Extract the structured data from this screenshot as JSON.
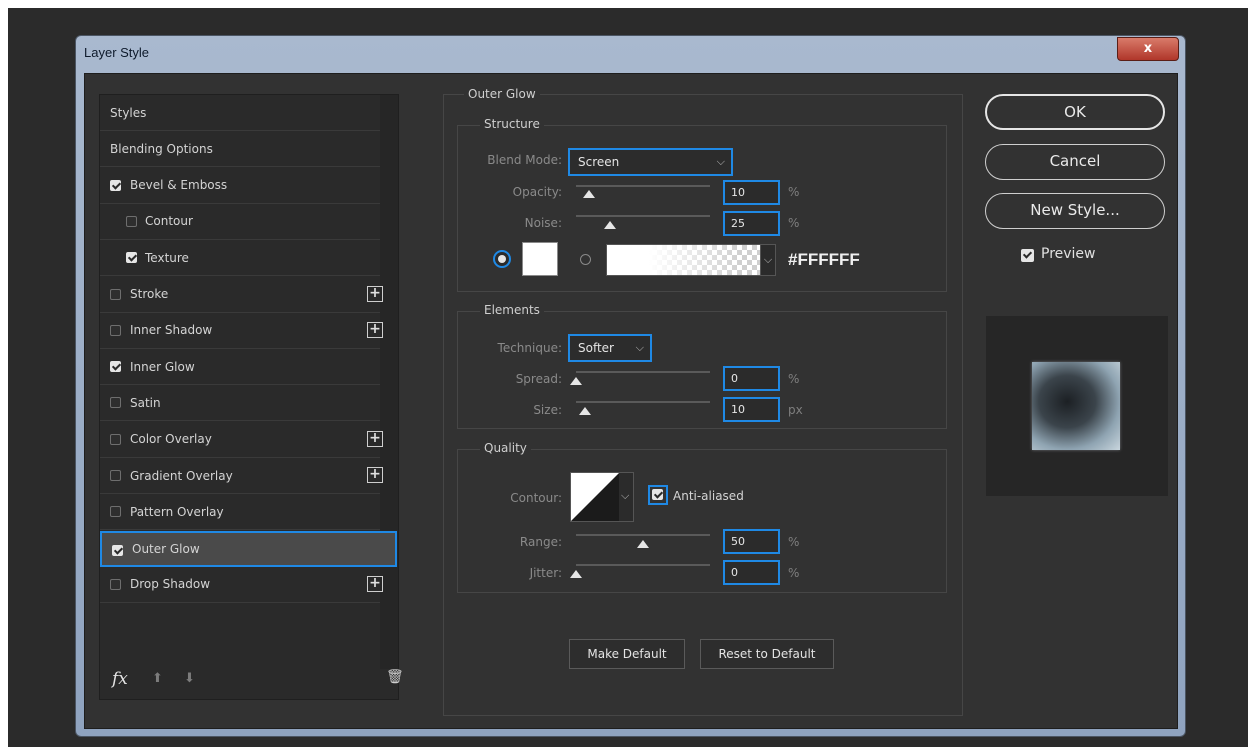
{
  "window": {
    "title": "Layer Style",
    "close_label": "x"
  },
  "sidebar": {
    "items": [
      {
        "label": "Styles",
        "checkbox": null,
        "plus": false,
        "sub": false,
        "selected": false
      },
      {
        "label": "Blending Options",
        "checkbox": null,
        "plus": false,
        "sub": false,
        "selected": false
      },
      {
        "label": "Bevel & Emboss",
        "checkbox": true,
        "plus": false,
        "sub": false,
        "selected": false
      },
      {
        "label": "Contour",
        "checkbox": false,
        "plus": false,
        "sub": true,
        "selected": false
      },
      {
        "label": "Texture",
        "checkbox": true,
        "plus": false,
        "sub": true,
        "selected": false
      },
      {
        "label": "Stroke",
        "checkbox": false,
        "plus": true,
        "sub": false,
        "selected": false
      },
      {
        "label": "Inner Shadow",
        "checkbox": false,
        "plus": true,
        "sub": false,
        "selected": false
      },
      {
        "label": "Inner Glow",
        "checkbox": true,
        "plus": false,
        "sub": false,
        "selected": false
      },
      {
        "label": "Satin",
        "checkbox": false,
        "plus": false,
        "sub": false,
        "selected": false
      },
      {
        "label": "Color Overlay",
        "checkbox": false,
        "plus": true,
        "sub": false,
        "selected": false
      },
      {
        "label": "Gradient Overlay",
        "checkbox": false,
        "plus": true,
        "sub": false,
        "selected": false
      },
      {
        "label": "Pattern Overlay",
        "checkbox": false,
        "plus": false,
        "sub": false,
        "selected": false
      },
      {
        "label": "Outer Glow",
        "checkbox": true,
        "plus": false,
        "sub": false,
        "selected": true
      },
      {
        "label": "Drop Shadow",
        "checkbox": false,
        "plus": true,
        "sub": false,
        "selected": false
      }
    ],
    "footer": {
      "fx_icon": "fx-icon",
      "up_icon": "arrow-up-icon",
      "down_icon": "arrow-down-icon",
      "trash_icon": "trash-icon"
    }
  },
  "outer_glow": {
    "title": "Outer Glow",
    "structure": {
      "legend": "Structure",
      "blend_mode_label": "Blend Mode:",
      "blend_mode_value": "Screen",
      "opacity_label": "Opacity:",
      "opacity_value": "10",
      "opacity_unit": "%",
      "opacity_fraction": 0.1,
      "noise_label": "Noise:",
      "noise_value": "25",
      "noise_unit": "%",
      "noise_fraction": 0.25,
      "color_hex": "#FFFFFF",
      "selected_source": "color"
    },
    "elements": {
      "legend": "Elements",
      "technique_label": "Technique:",
      "technique_value": "Softer",
      "spread_label": "Spread:",
      "spread_value": "0",
      "spread_unit": "%",
      "spread_fraction": 0,
      "size_label": "Size:",
      "size_value": "10",
      "size_unit": "px",
      "size_fraction": 0.07
    },
    "quality": {
      "legend": "Quality",
      "contour_label": "Contour:",
      "anti_aliased_label": "Anti-aliased",
      "anti_aliased": true,
      "range_label": "Range:",
      "range_value": "50",
      "range_unit": "%",
      "range_fraction": 0.5,
      "jitter_label": "Jitter:",
      "jitter_value": "0",
      "jitter_unit": "%",
      "jitter_fraction": 0
    },
    "make_default_label": "Make Default",
    "reset_default_label": "Reset to Default"
  },
  "right": {
    "ok_label": "OK",
    "cancel_label": "Cancel",
    "new_style_label": "New Style...",
    "preview_label": "Preview",
    "preview_checked": true
  },
  "colors": {
    "accent": "#1f89e5",
    "panel": "#323232",
    "title_bar": "#9fb1c9"
  }
}
